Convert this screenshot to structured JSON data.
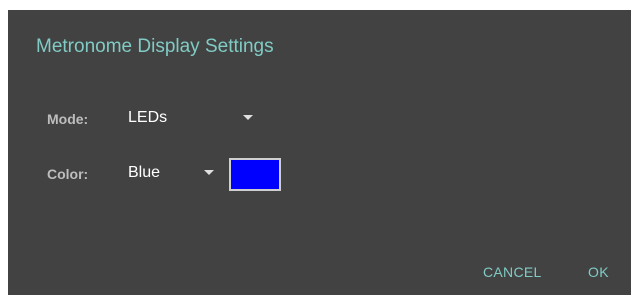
{
  "dialog": {
    "title": "Metronome Display Settings",
    "mode": {
      "label": "Mode:",
      "value": "LEDs",
      "icon": "dropdown-arrow-icon"
    },
    "color": {
      "label": "Color:",
      "value": "Blue",
      "icon": "dropdown-arrow-icon",
      "swatch_color": "#0000ff"
    },
    "buttons": {
      "cancel": "CANCEL",
      "ok": "OK"
    },
    "colors": {
      "background": "#424242",
      "accent": "#80cbc4",
      "label": "#bdbdbd",
      "value": "#ffffff"
    }
  }
}
